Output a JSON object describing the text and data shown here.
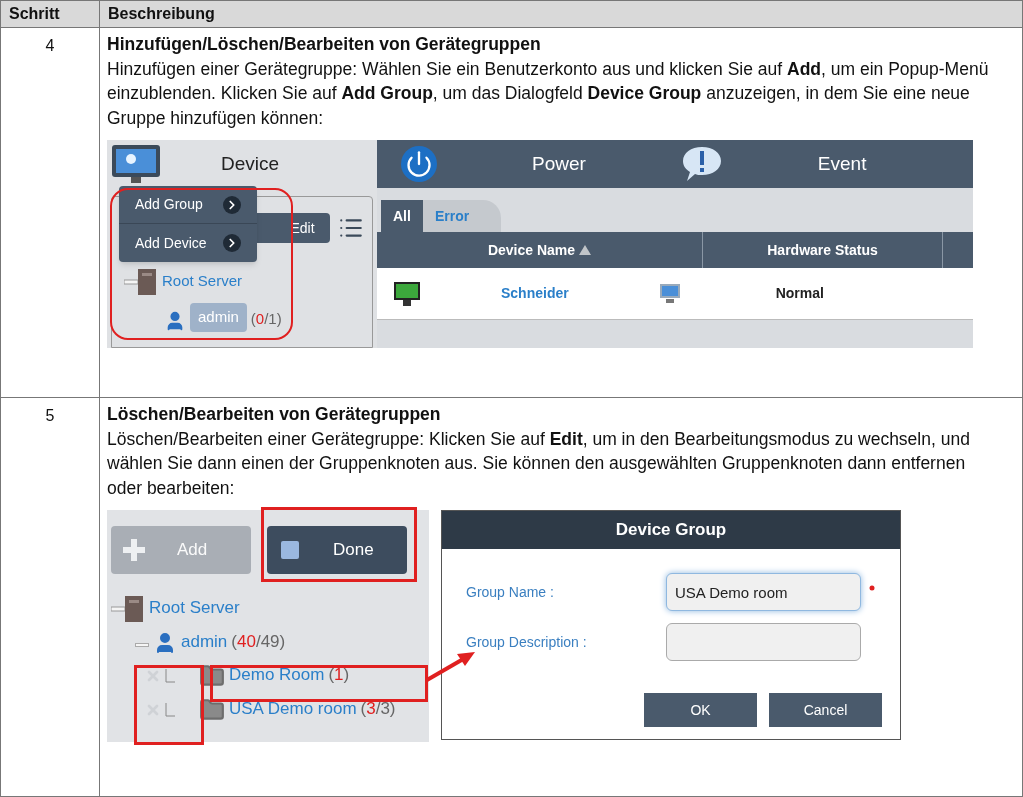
{
  "table": {
    "columns": [
      "Schritt",
      "Beschreibung"
    ],
    "rows": [
      {
        "step": "4",
        "title": "Hinzufügen/Löschen/Bearbeiten von Gerätegruppen",
        "text": "Hinzufügen einer Gerätegruppe: Wählen Sie ein Benutzerkonto aus und klicken Sie auf **Add**, um ein Popup-Menü einzublenden. Klicken Sie auf **Add Group**, um das Dialogfeld **Device Group** anzuzeigen, in dem Sie eine neue Gruppe hinzufügen können:",
        "screenshot": {
          "kind": "device_view",
          "nav": [
            "Device",
            "Power",
            "Event"
          ],
          "menu": [
            "Add Group",
            "Add Device"
          ],
          "edit_button": "Edit",
          "tree": {
            "label": "Root Server",
            "children": [
              {
                "label": "admin",
                "selected": true,
                "count": [
                  {
                    "text": "(",
                    "highlight": false
                  },
                  {
                    "text": "0",
                    "highlight": true
                  },
                  {
                    "text": "/1)",
                    "highlight": false
                  }
                ]
              }
            ]
          },
          "tabs": [
            {
              "label": "All",
              "selected": true
            },
            {
              "label": "Error",
              "selected": false
            }
          ],
          "columns": [
            {
              "label": "Device Name",
              "sorted": true
            },
            {
              "label": "Hardware Status",
              "sorted": false
            }
          ],
          "rows": [
            {
              "name": "Schneider",
              "status": "Normal"
            }
          ]
        }
      },
      {
        "step": "5",
        "title": "Löschen/Bearbeiten von Gerätegruppen",
        "text": "Löschen/Bearbeiten einer Gerätegruppe: Klicken Sie auf **Edit**, um in den Bearbeitungsmodus zu wechseln, und wählen Sie dann einen der Gruppenknoten aus. Sie können den ausgewählten Gruppenknoten dann entfernen oder bearbeiten:",
        "screenshot": {
          "kind": "edit_view",
          "buttons": [
            {
              "label": "Add",
              "disabled": true
            },
            {
              "label": "Done",
              "disabled": false
            }
          ],
          "tree": {
            "label": "Root Server",
            "children": [
              {
                "label": "admin",
                "selected": false,
                "count": [
                  {
                    "text": "(",
                    "highlight": false
                  },
                  {
                    "text": "40",
                    "highlight": true
                  },
                  {
                    "text": "/49)",
                    "highlight": false
                  }
                ],
                "children": [
                  {
                    "label": "Demo Room",
                    "removable": true,
                    "count": [
                      {
                        "text": "(",
                        "highlight": false
                      },
                      {
                        "text": "1",
                        "highlight": true
                      },
                      {
                        "text": ")",
                        "highlight": false
                      }
                    ]
                  },
                  {
                    "label": "USA Demo room",
                    "removable": true,
                    "count": [
                      {
                        "text": "(",
                        "highlight": false
                      },
                      {
                        "text": "3",
                        "highlight": true
                      },
                      {
                        "text": "/3)",
                        "highlight": false
                      }
                    ]
                  }
                ]
              }
            ]
          },
          "dialog": {
            "title": "Device Group",
            "fields": [
              {
                "label": "Group Name :",
                "value": "USA Demo room",
                "required": true,
                "focused": true
              },
              {
                "label": "Group Description :",
                "required": false,
                "focused": false
              }
            ],
            "buttons": [
              "OK",
              "Cancel"
            ]
          }
        }
      }
    ]
  }
}
